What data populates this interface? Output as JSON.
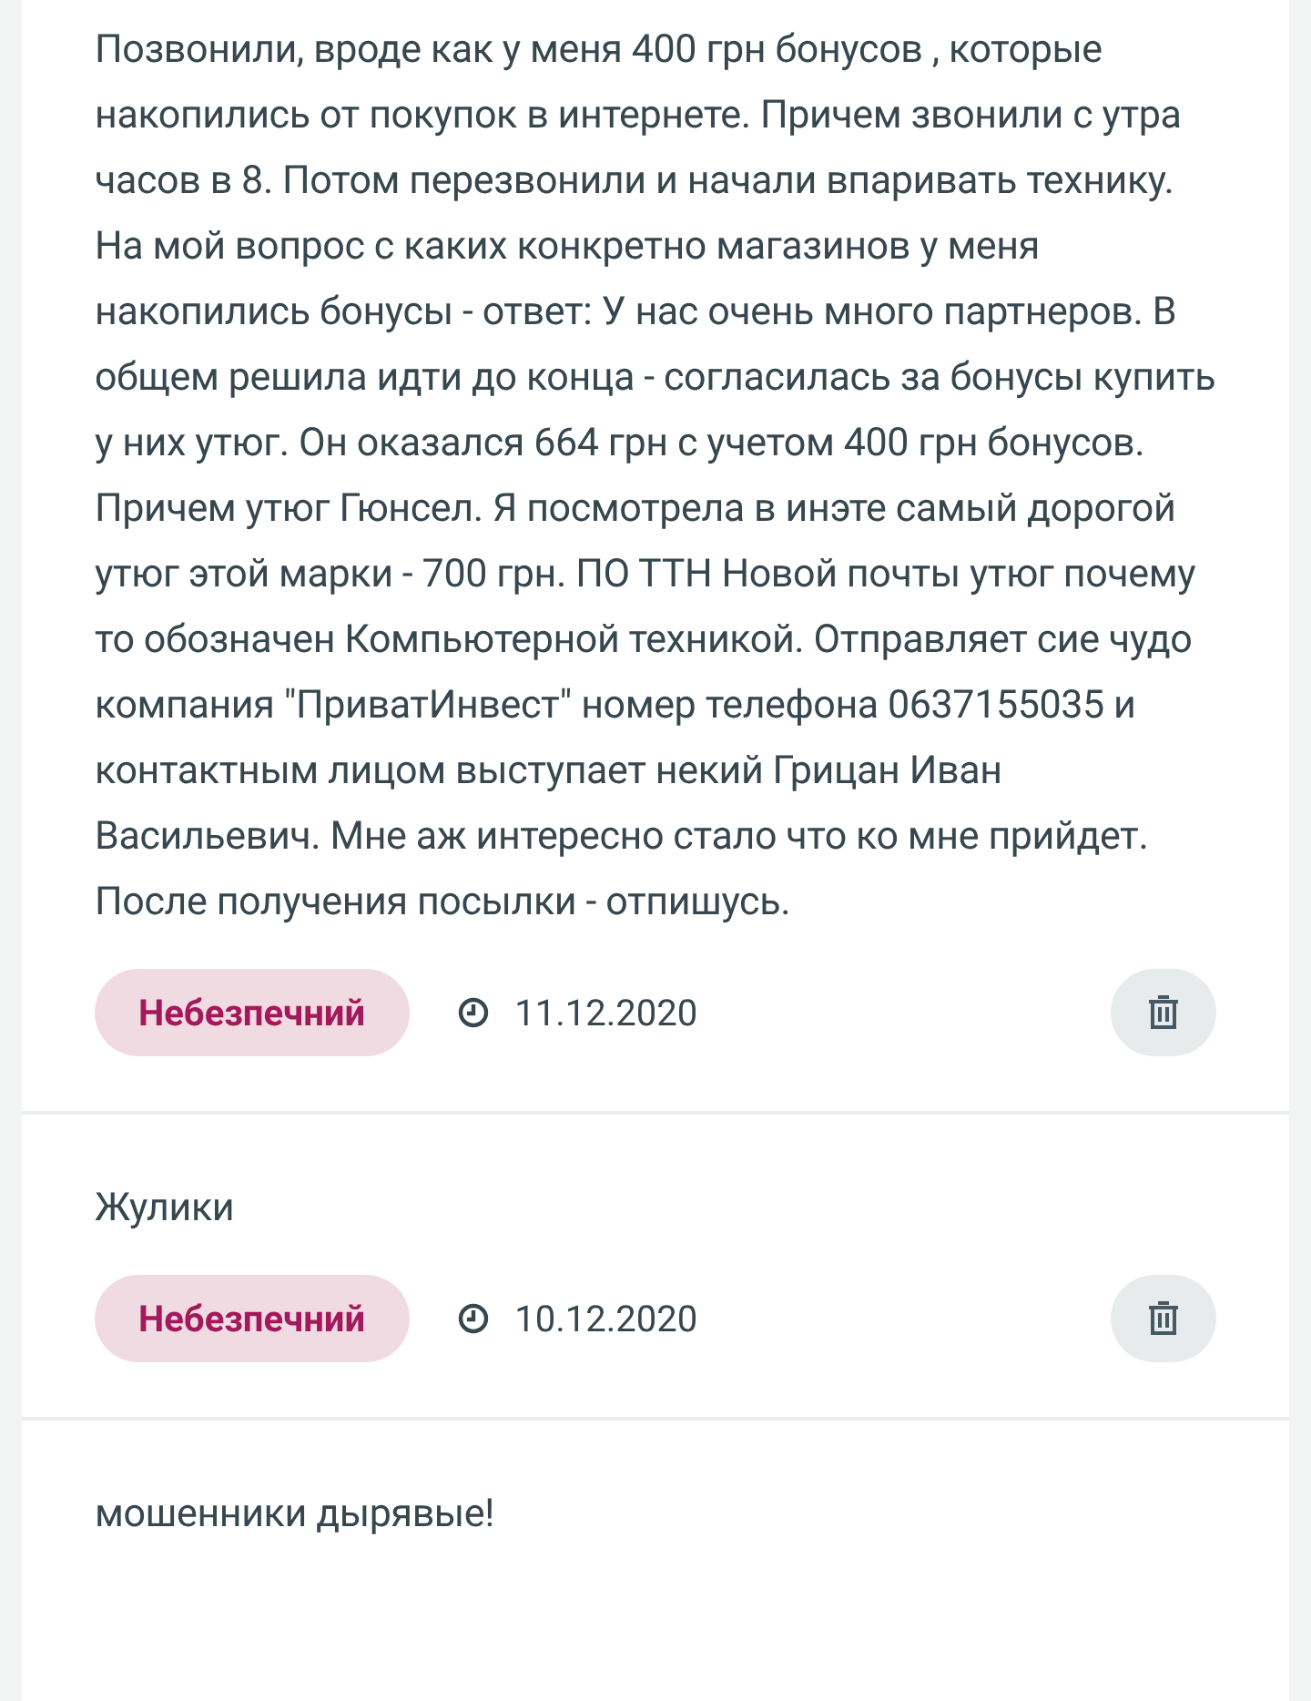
{
  "reviews": [
    {
      "text": "Позвонили, вроде как у меня 400 грн бонусов , которые накопились от покупок в интернете. Причем звонили с утра часов в 8. Потом перезвонили и начали впаривать технику. На мой вопрос с каких конкретно магазинов у меня накопились бонусы - ответ: У нас очень много партнеров. В общем решила идти до конца - согласилась за бонусы купить у них утюг. Он оказался 664 грн с учетом 400 грн бонусов. Причем утюг Гюнсел. Я посмотрела в инэте самый дорогой утюг этой марки - 700 грн. ПО ТТН Новой почты утюг почему то обозначен Компьютерной техникой. Отправляет сие чудо компания \"ПриватИнвест\" номер телефона 0637155035 и контактным лицом выступает некий Грицан Иван Васильевич. Мне аж интересно стало что ко мне прийдет. После получения посылки - отпишусь.",
      "badge": {
        "label": "Небезпечний",
        "kind": "danger"
      },
      "date": "11.12.2020"
    },
    {
      "text": "Жулики",
      "badge": {
        "label": "Небезпечний",
        "kind": "danger"
      },
      "date": "10.12.2020"
    },
    {
      "text": "мошенники дырявые!"
    }
  ]
}
